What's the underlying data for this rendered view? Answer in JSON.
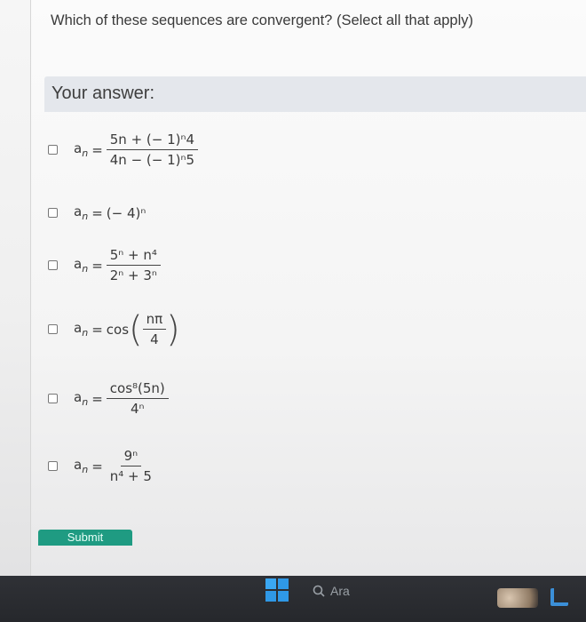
{
  "question": "Which of these sequences are convergent? (Select all that apply)",
  "answer_label": "Your answer:",
  "options": [
    {
      "an": "a",
      "sub": "n",
      "eq": "=",
      "num": "5n + (− 1)ⁿ4",
      "den": "4n − (− 1)ⁿ5"
    },
    {
      "an": "a",
      "sub": "n",
      "eq": "=",
      "expr": "(− 4)ⁿ"
    },
    {
      "an": "a",
      "sub": "n",
      "eq": "=",
      "num": "5ⁿ + n⁴",
      "den": "2ⁿ + 3ⁿ"
    },
    {
      "an": "a",
      "sub": "n",
      "eq": "=",
      "func": "cos",
      "num": "nπ",
      "den": "4"
    },
    {
      "an": "a",
      "sub": "n",
      "eq": "=",
      "num": "cos⁸(5n)",
      "den": "4ⁿ"
    },
    {
      "an": "a",
      "sub": "n",
      "eq": "=",
      "num": "9ⁿ",
      "den": "n⁴ + 5"
    }
  ],
  "submit_label": "Submit",
  "taskbar": {
    "search_label": "Ara"
  },
  "colors": {
    "accent": "#1f9b82",
    "answer_bar": "#e4e7ec",
    "taskbar": "#2b2d31",
    "windows_logo": "#2f98e6"
  },
  "icons": {
    "search": "search-icon",
    "windows": "windows-start-icon"
  }
}
